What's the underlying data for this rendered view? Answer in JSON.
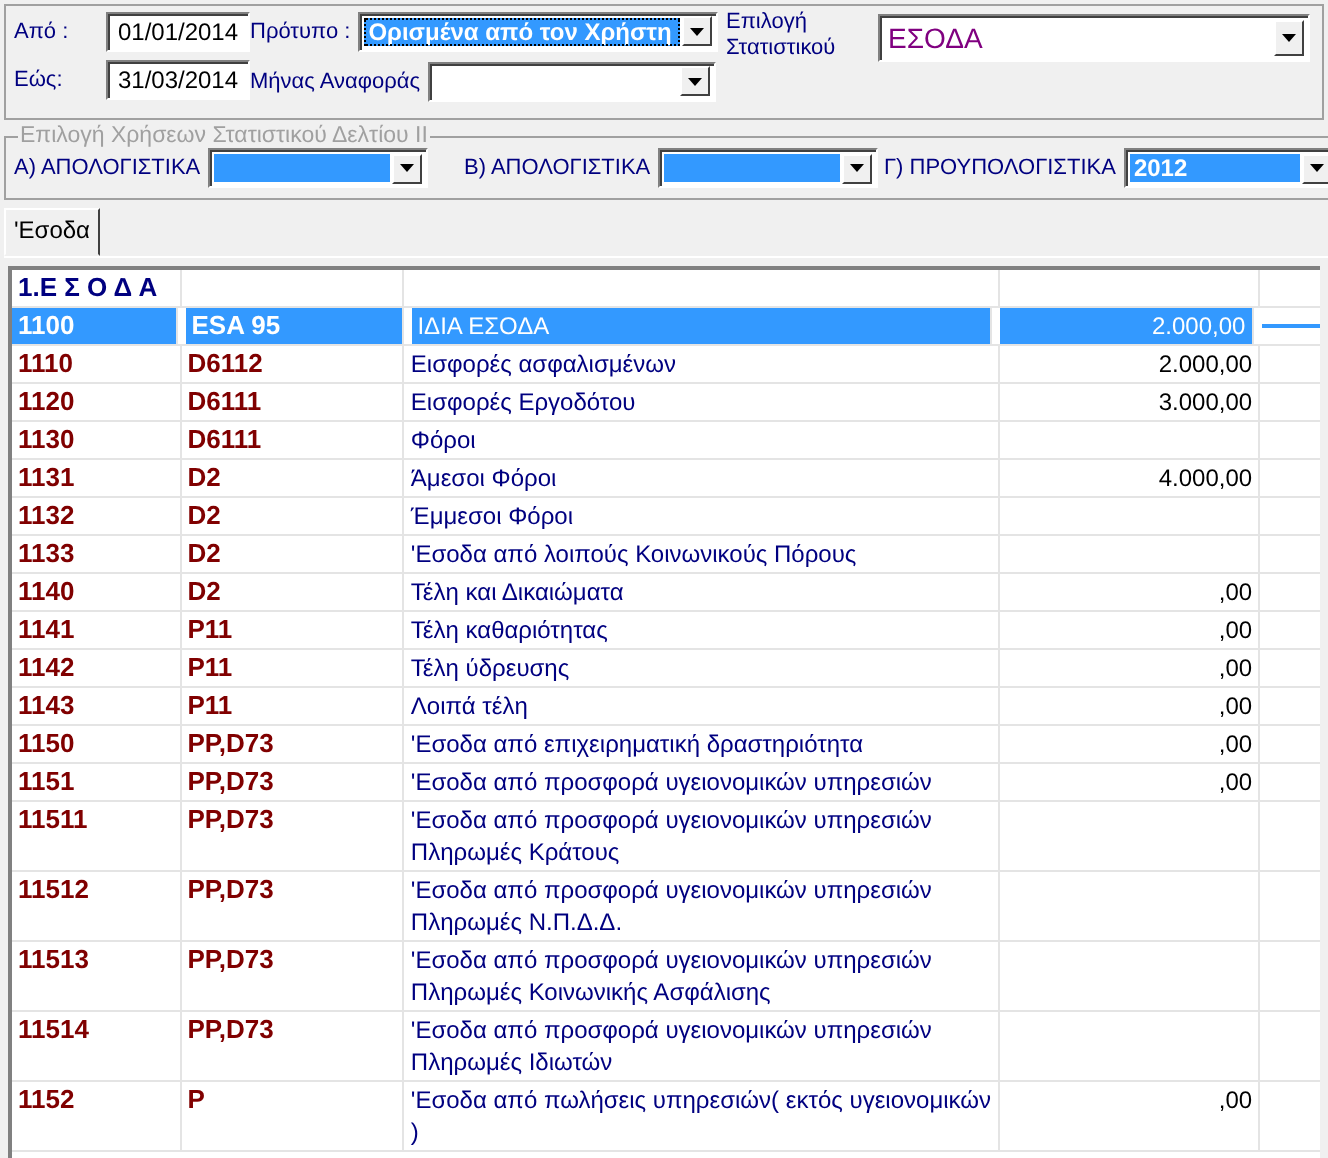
{
  "filters": {
    "from": {
      "label": "Από :",
      "value": "01/01/2014"
    },
    "to": {
      "label": "Εώς:",
      "value": "31/03/2014"
    },
    "template": {
      "label": "Πρότυπο :",
      "value": "Ορισμένα από τον Χρήστη",
      "highlighted": true
    },
    "month": {
      "label": "Μήνας Αναφοράς",
      "highlighted": false
    },
    "statistic": {
      "label": "Επιλογή Στατιστικού",
      "value": "ΕΣΟΔΑ",
      "highlighted": false
    }
  },
  "usage_group": {
    "title": "Επιλογή Χρήσεων Στατιστικού Δελτίου ΙΙ",
    "disabled": true,
    "selectors": [
      {
        "label": "Α) ΑΠΟΛΟΓΙΣΤΙΚΑ",
        "highlighted": true
      },
      {
        "label": "Β) ΑΠΟΛΟΓΙΣΤΙΚΑ",
        "highlighted": true
      },
      {
        "label": "Γ) ΠΡΟΥΠΟΛΟΓΙΣΤΙΚΑ",
        "value": "2012",
        "highlighted": true
      }
    ]
  },
  "tabs": [
    {
      "label": "'Εσοδα",
      "selected": true
    }
  ],
  "grid": {
    "section": "1.Ε Σ Ο Δ Α",
    "rows": [
      {
        "code": "1100",
        "esa": "ESA 95",
        "description": "ΙΔΙΑ ΕΣΟΔΑ",
        "amount": "2.000,00",
        "selected": true
      },
      {
        "code": "1110",
        "esa": "D6112",
        "description": "Εισφορές ασφαλισμένων",
        "amount": "2.000,00",
        "selected": false
      },
      {
        "code": "1120",
        "esa": "D6111",
        "description": "Εισφορές Εργοδότου",
        "amount": "3.000,00",
        "selected": false
      },
      {
        "code": "1130",
        "esa": "D6111",
        "description": "Φόροι",
        "selected": false
      },
      {
        "code": "1131",
        "esa": "D2",
        "description": "Άμεσοι Φόροι",
        "amount": "4.000,00",
        "selected": false
      },
      {
        "code": "1132",
        "esa": "D2",
        "description": "Έμμεσοι Φόροι",
        "selected": false
      },
      {
        "code": "1133",
        "esa": "D2",
        "description": "'Εσοδα από λοιπούς Κοινωνικούς Πόρους",
        "selected": false
      },
      {
        "code": "1140",
        "esa": "D2",
        "description": "Τέλη και Δικαιώματα",
        "amount": ",00",
        "selected": false
      },
      {
        "code": "1141",
        "esa": "P11",
        "description": "Τέλη καθαριότητας",
        "amount": ",00",
        "selected": false
      },
      {
        "code": "1142",
        "esa": "P11",
        "description": "Τέλη ύδρευσης",
        "amount": ",00",
        "selected": false
      },
      {
        "code": "1143",
        "esa": "P11",
        "description": "Λοιπά τέλη",
        "amount": ",00",
        "selected": false
      },
      {
        "code": "1150",
        "esa": "PP,D73",
        "description": "'Εσοδα από επιχειρηματική δραστηριότητα",
        "amount": ",00",
        "selected": false
      },
      {
        "code": "1151",
        "esa": "PP,D73",
        "description": "'Εσοδα από προσφορά υγειονομικών υπηρεσιών",
        "amount": ",00",
        "selected": false
      },
      {
        "code": "11511",
        "esa": "PP,D73",
        "description": "'Εσοδα από προσφορά υγειονομικών υπηρεσιών Πληρωμές Κράτους",
        "selected": false
      },
      {
        "code": "11512",
        "esa": "PP,D73",
        "description": "'Εσοδα από προσφορά υγειονομικών υπηρεσιών Πληρωμές Ν.Π.Δ.Δ.",
        "selected": false
      },
      {
        "code": "11513",
        "esa": "PP,D73",
        "description": "'Εσοδα από προσφορά υγειονομικών υπηρεσιών Πληρωμές Κοινωνικής Ασφάλισης",
        "selected": false
      },
      {
        "code": "11514",
        "esa": "PP,D73",
        "description": "'Εσοδα από προσφορά υγειονομικών υπηρεσιών Πληρωμές Ιδιωτών",
        "selected": false
      },
      {
        "code": "1152",
        "esa": "P",
        "description": "'Εσοδα από πωλήσεις υπηρεσιών( εκτός υγειονομικών )",
        "amount": ",00",
        "selected": false
      }
    ]
  }
}
